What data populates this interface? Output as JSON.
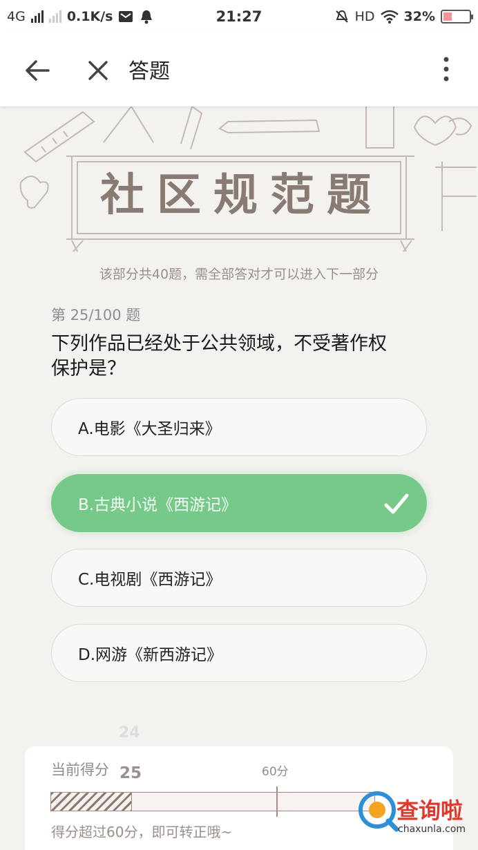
{
  "status_bar": {
    "network": "4G",
    "speed": "0.1K/s",
    "time": "21:27",
    "hd": "HD",
    "battery": "32%",
    "battery_level": 0.32,
    "icons": [
      "signal-icon",
      "mail-icon",
      "notification-bell-icon",
      "mute-icon",
      "wifi-icon",
      "battery-icon"
    ]
  },
  "app_bar": {
    "title": "答题",
    "icons": [
      "back-arrow-icon",
      "close-icon",
      "more-vertical-icon"
    ]
  },
  "banner": {
    "title": "社区规范题",
    "subtitle": "该部分共40题，需全部答对才可以进入下一部分"
  },
  "question": {
    "number": "第 25/100 题",
    "text_line1": "下列作品已经处于公共领域，不受著作权",
    "text_line2": "保护是？",
    "options": [
      {
        "label": "A.电影《大圣归来》",
        "selected": false
      },
      {
        "label": "B.古典小说《西游记》",
        "selected": true
      },
      {
        "label": "C.电视剧《西游记》",
        "selected": false
      },
      {
        "label": "D.网游《新西游记》",
        "selected": false
      }
    ]
  },
  "score": {
    "previous": "24",
    "label": "当前得分",
    "current": "25",
    "pass_label": "60分",
    "progress_fraction": 0.25,
    "pass_fraction": 0.6,
    "hint": "得分超过60分，即可转正哦~"
  },
  "watermark": {
    "brand": "查询啦",
    "url": "chaxunla.com"
  },
  "colors": {
    "accent_green": "#77c98a",
    "sketch_brown": "#8a7a74",
    "watermark_red": "#e0382f"
  }
}
